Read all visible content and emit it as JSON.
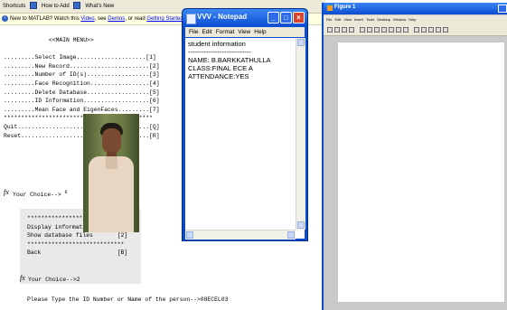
{
  "matlab": {
    "shortcuts_bar": {
      "shortcuts_label": "Shortcuts",
      "how_to_add": "How to Add",
      "whats_new": "What's New"
    },
    "info_bar": {
      "prefix": "New to MATLAB? Watch this ",
      "video_link": "Video",
      "mid1": ", see ",
      "demos_link": "Demos",
      "mid2": ", or read ",
      "getting_started_link": "Getting Started",
      "suffix": "."
    },
    "main_menu_text": "             <<MAIN MENU>>\n\n.........Select Image....................[1]\n.........New Record.......................[2]\n.........Number of ID(s)..................[3]\n.........Face Recognition.................[4]\n.........Delete Database..................[5]\n.........ID Information...................[6]\n.........Mean Face and EigenFaces.........[7]\n*******************************************\nQuit......................................[Q]\nReset.....................................[R]",
    "fx_symbol": "fx",
    "choice_prompt_1": "Your Choice--> ",
    "choice_value_1": "6",
    "submenu_text": "****************************\nDisplay information       [1]\nShow database files       [2]\n****************************\nBack                      [B]",
    "choice_prompt_2": "Your Choice-->2",
    "final_prompt": "Please Type the ID Number or Name of the person-->08ECEL03"
  },
  "notepad": {
    "title": "VVV - Notepad",
    "menu": [
      "File",
      "Edit",
      "Format",
      "View",
      "Help"
    ],
    "content": "student information\n----------------------------\nNAME: B.BARKKATHULLA\nCLASS:FINAL ECE A\nATTENDANCE:YES",
    "icons": {
      "minimize": "minimize-icon",
      "maximize": "maximize-icon",
      "close": "close-icon"
    }
  },
  "figure": {
    "title": "Figure 1",
    "menu": [
      "File",
      "Edit",
      "View",
      "Insert",
      "Tools",
      "Desktop",
      "Window",
      "Help"
    ],
    "toolbar_icons": [
      "new-figure-icon",
      "open-file-icon",
      "save-icon",
      "print-icon",
      "edit-plot-icon",
      "zoom-in-icon",
      "zoom-out-icon",
      "pan-icon",
      "rotate-icon",
      "data-cursor-icon",
      "brush-icon",
      "link-icon",
      "colorbar-icon",
      "legend-icon",
      "hide-plot-tools-icon",
      "show-plot-tools-icon"
    ]
  },
  "colors": {
    "xp_blue": "#0a4bd0",
    "close_red": "#d5442b",
    "info_bar_bg": "#ffffe1",
    "submenu_bg": "#e9e9e9"
  }
}
